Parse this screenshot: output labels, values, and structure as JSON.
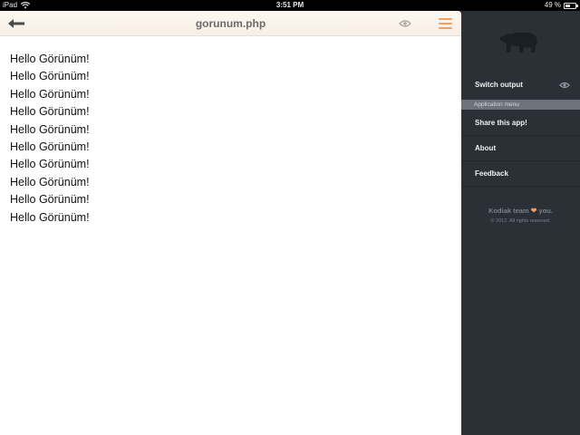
{
  "status_bar": {
    "device": "iPad",
    "time": "3:51 PM",
    "battery": "49 %"
  },
  "topbar": {
    "title": "gorunum.php"
  },
  "output": {
    "lines": [
      "Hello Görünüm!",
      "Hello Görünüm!",
      "Hello Görünüm!",
      "Hello Görünüm!",
      "Hello Görünüm!",
      "Hello Görünüm!",
      "Hello Görünüm!",
      "Hello Görünüm!",
      "Hello Görünüm!",
      "Hello Görünüm!"
    ]
  },
  "sidebar": {
    "switch_output": "Switch output",
    "section_header": "Application menu",
    "items": [
      "Share this app!",
      "About",
      "Feedback"
    ],
    "credits_prefix": "Kodiak team",
    "credits_suffix": "you.",
    "copyright": "© 2012. All rights reserved."
  },
  "colors": {
    "accent": "#f0a060",
    "sidebar_bg": "#2b2f36",
    "topbar_bg": "#fdf8f2"
  }
}
